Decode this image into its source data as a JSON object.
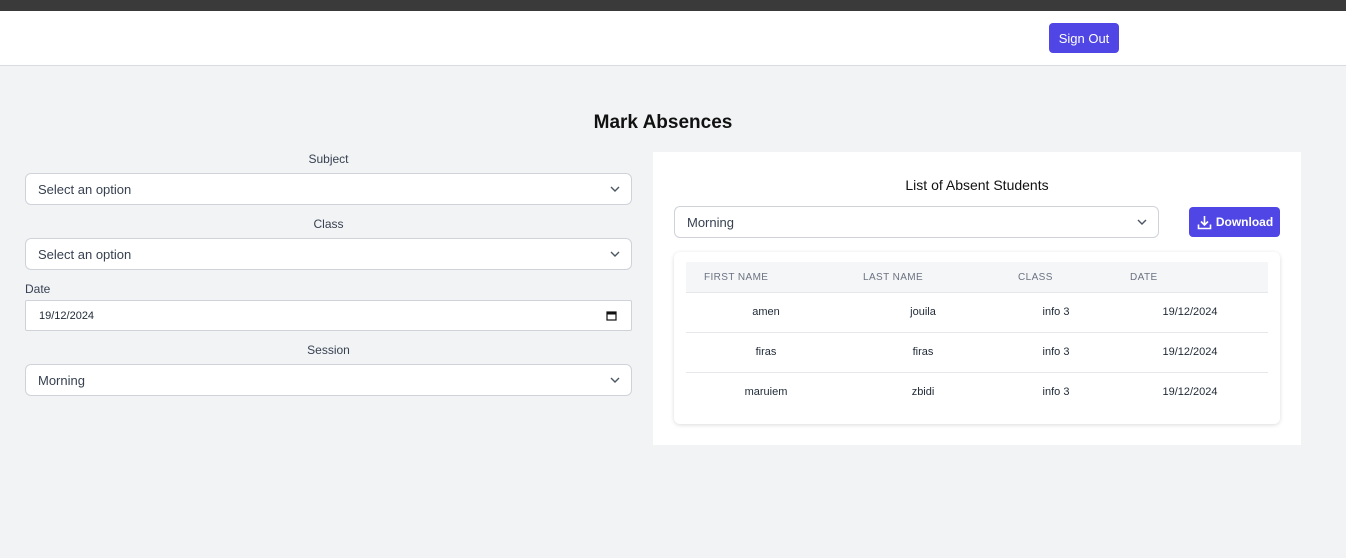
{
  "header": {
    "sign_out_label": "Sign Out"
  },
  "page": {
    "title": "Mark Absences"
  },
  "form": {
    "subject": {
      "label": "Subject",
      "value": "Select an option"
    },
    "class": {
      "label": "Class",
      "value": "Select an option"
    },
    "date": {
      "label": "Date",
      "value": "19/12/2024"
    },
    "session": {
      "label": "Session",
      "value": "Morning"
    }
  },
  "absent_panel": {
    "title": "List of Absent Students",
    "session_filter": "Morning",
    "download_label": "Download",
    "columns": [
      "FIRST NAME",
      "LAST NAME",
      "CLASS",
      "DATE"
    ],
    "rows": [
      {
        "first_name": "amen",
        "last_name": "jouila",
        "class": "info 3",
        "date": "19/12/2024"
      },
      {
        "first_name": "firas",
        "last_name": "firas",
        "class": "info 3",
        "date": "19/12/2024"
      },
      {
        "first_name": "maruiem",
        "last_name": "zbidi",
        "class": "info 3",
        "date": "19/12/2024"
      }
    ]
  },
  "colors": {
    "accent": "#4f46e5",
    "background": "#f2f3f5",
    "topbar": "#3a3a3a"
  },
  "icons": [
    "chevron-down-icon",
    "calendar-icon",
    "download-icon"
  ]
}
